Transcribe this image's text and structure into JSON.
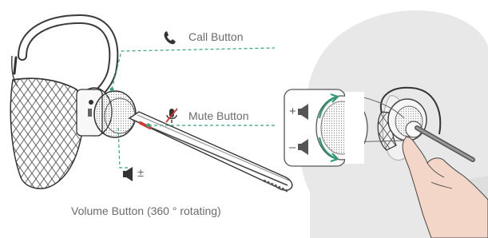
{
  "labels": {
    "call_button": "Call Button",
    "mute_button": "Mute Button",
    "volume_caption": "Volume Button (360 ° rotating)",
    "volume_symbol": "±",
    "plus_symbol": "+",
    "minus_symbol": "–"
  },
  "icons": {
    "call": "phone-icon",
    "mute": "muted-microphone-icon",
    "volume": "speaker-icon",
    "rotation": "rotation-arrows-icon",
    "hand": "finger-pressing-hand"
  },
  "colors": {
    "leader_lines": "#3aa47a",
    "rotation_arrow": "#2e9a74",
    "mute_accent": "#d23a3a",
    "head_silhouette": "#e8e8e8",
    "skin": "#f3d6c8"
  }
}
